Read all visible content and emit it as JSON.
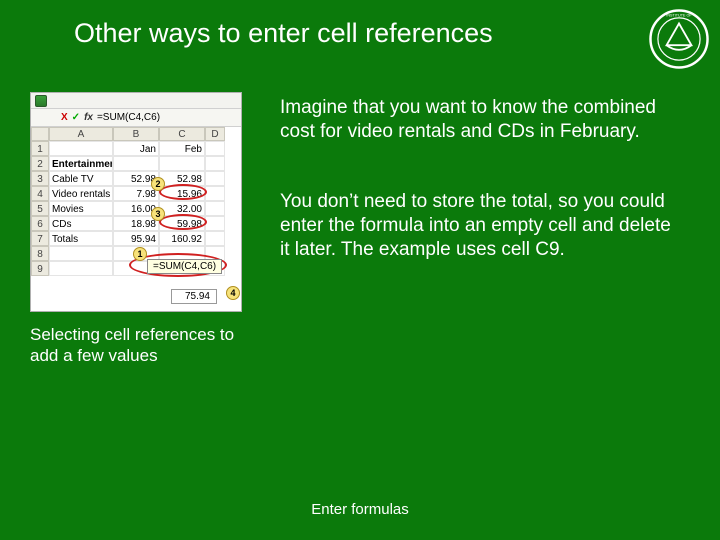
{
  "title": "Other ways to enter cell references",
  "logo": {
    "name": "institute-seal"
  },
  "spreadsheet": {
    "formula_bar": {
      "cancel": "X",
      "enter": "✓",
      "fx": "fx",
      "formula": "=SUM(C4,C6)"
    },
    "col_headers": [
      "",
      "A",
      "B",
      "C",
      "D"
    ],
    "rows": [
      {
        "n": "1",
        "a": "",
        "b": "Jan",
        "c": "Feb",
        "d": ""
      },
      {
        "n": "2",
        "a": "Entertainment",
        "b": "",
        "c": "",
        "d": "",
        "bold": true
      },
      {
        "n": "3",
        "a": "Cable TV",
        "b": "52.98",
        "c": "52.98",
        "d": ""
      },
      {
        "n": "4",
        "a": "Video rentals",
        "b": "7.98",
        "c": "15.96",
        "d": ""
      },
      {
        "n": "5",
        "a": "Movies",
        "b": "16.00",
        "c": "32.00",
        "d": ""
      },
      {
        "n": "6",
        "a": "CDs",
        "b": "18.98",
        "c": "59.98",
        "d": ""
      },
      {
        "n": "7",
        "a": "Totals",
        "b": "95.94",
        "c": "160.92",
        "d": ""
      },
      {
        "n": "8",
        "a": "",
        "b": "",
        "c": "",
        "d": ""
      },
      {
        "n": "9",
        "a": "",
        "b": "",
        "c": "",
        "d": ""
      }
    ],
    "annotations": {
      "a1": "1",
      "a2": "2",
      "a3": "3",
      "a4": "4"
    },
    "tooltip_formula": "=SUM(C4,C6)",
    "result_value": "75.94"
  },
  "paragraph1": "Imagine that you want to know the combined cost for video rentals and CDs in February.",
  "paragraph2": "You don’t need to store the total, so you could enter the formula into an empty cell and delete it later. The example uses cell C9.",
  "caption": "Selecting cell references to add a few values",
  "footer": "Enter formulas"
}
